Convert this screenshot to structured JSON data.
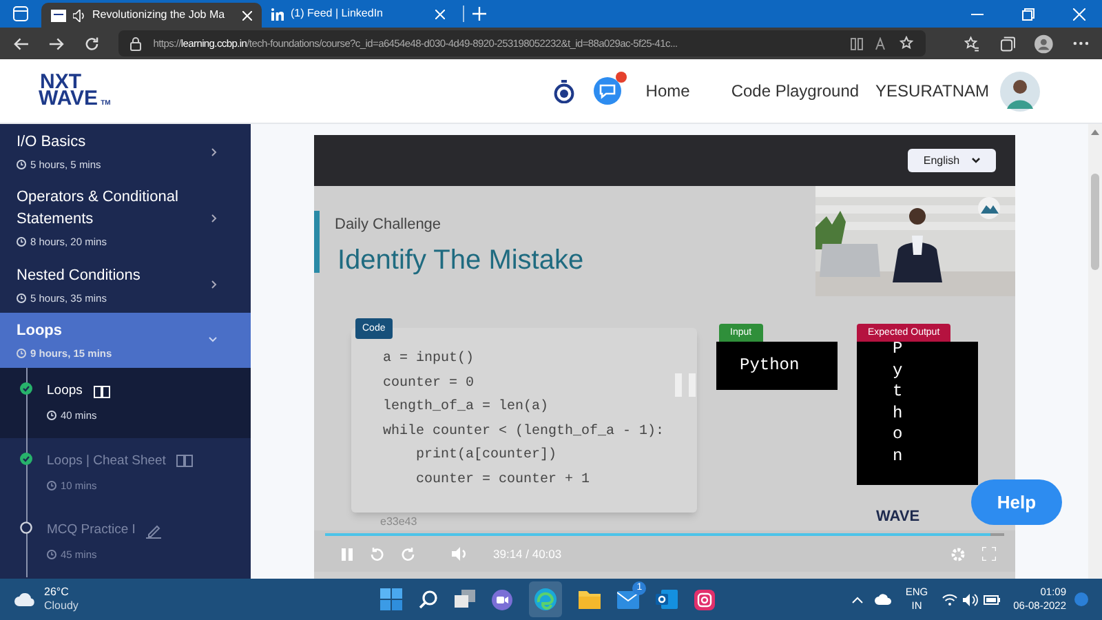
{
  "browser": {
    "tabs": [
      {
        "title": "Revolutionizing the Job Ma",
        "selected": true
      },
      {
        "title": "(1) Feed | LinkedIn",
        "selected": false
      }
    ],
    "url": "https://**learning.ccbp.in**/tech-foundations/course?c_id=a6454e48-d030-4d49-8920-253198052232&t_id=88a029ac-5f25-41c..."
  },
  "header": {
    "logo": {
      "line1": "NXT",
      "line2": "WAVE",
      "mark": "TM"
    },
    "notification_dot": true,
    "nav": [
      "Home",
      "Code Playground"
    ],
    "user": "YESURATNAM"
  },
  "sidebar": {
    "items": [
      {
        "title": "I/O Basics",
        "duration": "5 hours, 5 mins",
        "expanded": false,
        "selected": false
      },
      {
        "title": "Operators & Conditional Statements",
        "duration": "8 hours, 20 mins",
        "expanded": false,
        "selected": false
      },
      {
        "title": "Nested Conditions",
        "duration": "5 hours, 35 mins",
        "expanded": false,
        "selected": false
      },
      {
        "title": "Loops",
        "duration": "9 hours, 15 mins",
        "expanded": true,
        "selected": true,
        "children": [
          {
            "title": "Loops",
            "duration": "40 mins",
            "kind": "reading",
            "done": true,
            "selected": true
          },
          {
            "title": "Loops | Cheat Sheet",
            "duration": "10 mins",
            "kind": "reading",
            "done": true,
            "selected": false
          },
          {
            "title": "MCQ Practice I",
            "duration": "45 mins",
            "kind": "practice",
            "done": false,
            "selected": false
          }
        ]
      }
    ]
  },
  "video": {
    "language": "English",
    "slide": {
      "subtitle": "Daily Challenge",
      "title": "Identify The Mistake",
      "code_label": "Code",
      "code": [
        "a = input()",
        "counter = 0",
        "length_of_a = len(a)",
        "while counter < (length_of_a - 1):",
        "    print(a[counter])",
        "    counter = counter + 1"
      ],
      "input_label": "Input",
      "input": "Python",
      "output_label": "Expected Output",
      "output": "Python",
      "logo": "WAVE",
      "watermark": "e33e43"
    },
    "playing": true,
    "level": 0.98,
    "time": "39:14 / 40:03"
  },
  "help_button": "Help",
  "taskbar": {
    "temperature": "26°C",
    "weather": "Cloudy",
    "mail_badge": "1",
    "language": "ENG",
    "region": "IN",
    "time": "01:09",
    "date": "06-08-2022"
  }
}
